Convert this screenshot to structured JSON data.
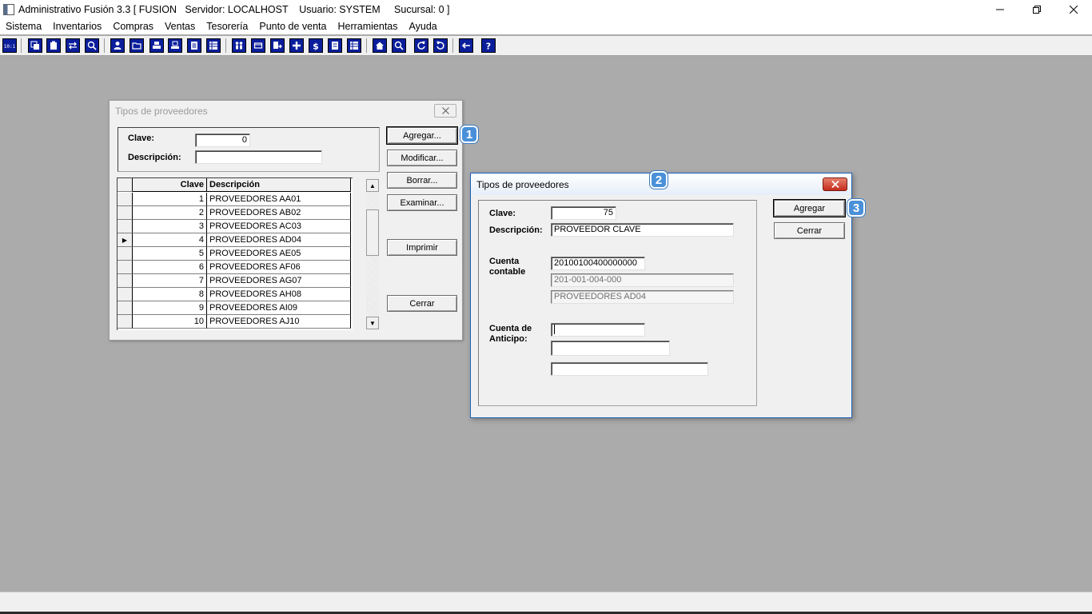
{
  "window": {
    "title": "Administrativo Fusión 3.3 [ FUSION   Servidor: LOCALHOST    Usuario: SYSTEM     Sucursal: 0 ]",
    "icon": "app-window-icon"
  },
  "menu": [
    "Sistema",
    "Inventarios",
    "Compras",
    "Ventas",
    "Tesorería",
    "Punto de venta",
    "Herramientas",
    "Ayuda"
  ],
  "toolbar": {
    "icons": [
      "calculator-icon",
      "copy-icon",
      "clipboard-icon",
      "swap-icon",
      "zoom-icon",
      "user-icon",
      "folder-icon",
      "print-icon",
      "printer-icon",
      "document-icon",
      "list-icon",
      "people-icon",
      "box-icon",
      "export-icon",
      "add-icon",
      "dollar-icon",
      "page-icon",
      "table-icon",
      "home-icon",
      "search-icon",
      "refresh-icon",
      "undo-icon",
      "back-arrow-icon",
      "help-icon"
    ]
  },
  "dialog1": {
    "title": "Tipos de proveedores",
    "clave_label": "Clave:",
    "clave_value": "0",
    "descripcion_label": "Descripción:",
    "descripcion_value": "",
    "buttons": {
      "agregar": "Agregar...",
      "modificar": "Modificar...",
      "borrar": "Borrar...",
      "examinar": "Examinar...",
      "imprimir": "Imprimir",
      "cerrar": "Cerrar"
    },
    "grid": {
      "headers": [
        "Clave",
        "Descripción"
      ],
      "selected_row": 3,
      "rows": [
        [
          "1",
          "PROVEEDORES AA01"
        ],
        [
          "2",
          "PROVEEDORES AB02"
        ],
        [
          "3",
          "PROVEEDORES AC03"
        ],
        [
          "4",
          "PROVEEDORES AD04"
        ],
        [
          "5",
          "PROVEEDORES AE05"
        ],
        [
          "6",
          "PROVEEDORES AF06"
        ],
        [
          "7",
          "PROVEEDORES AG07"
        ],
        [
          "8",
          "PROVEEDORES AH08"
        ],
        [
          "9",
          "PROVEEDORES AI09"
        ],
        [
          "10",
          "PROVEEDORES AJ10"
        ]
      ]
    }
  },
  "dialog2": {
    "title": "Tipos de proveedores",
    "clave_label": "Clave:",
    "clave_value": "75",
    "descripcion_label": "Descripción:",
    "descripcion_value": "PROVEEDOR CLAVE",
    "cuenta_contable_label_1": "Cuenta",
    "cuenta_contable_label_2": "contable",
    "cuenta_contable_value": "20100100400000000",
    "cuenta_contable_formatted": "201-001-004-000",
    "cuenta_contable_name": "PROVEEDORES AD04",
    "cuenta_anticipo_label_1": "Cuenta de",
    "cuenta_anticipo_label_2": "Anticipo:",
    "cuenta_anticipo_value": "",
    "cuenta_anticipo_formatted": "",
    "cuenta_anticipo_name": "",
    "buttons": {
      "agregar": "Agregar",
      "cerrar": "Cerrar"
    }
  },
  "badges": [
    "1",
    "2",
    "3"
  ],
  "colors": {
    "workspace": "#ababab",
    "toolbar_icon": "#0a1e9c",
    "badge": "#4a90d9",
    "close_button": "#c42b1c"
  }
}
